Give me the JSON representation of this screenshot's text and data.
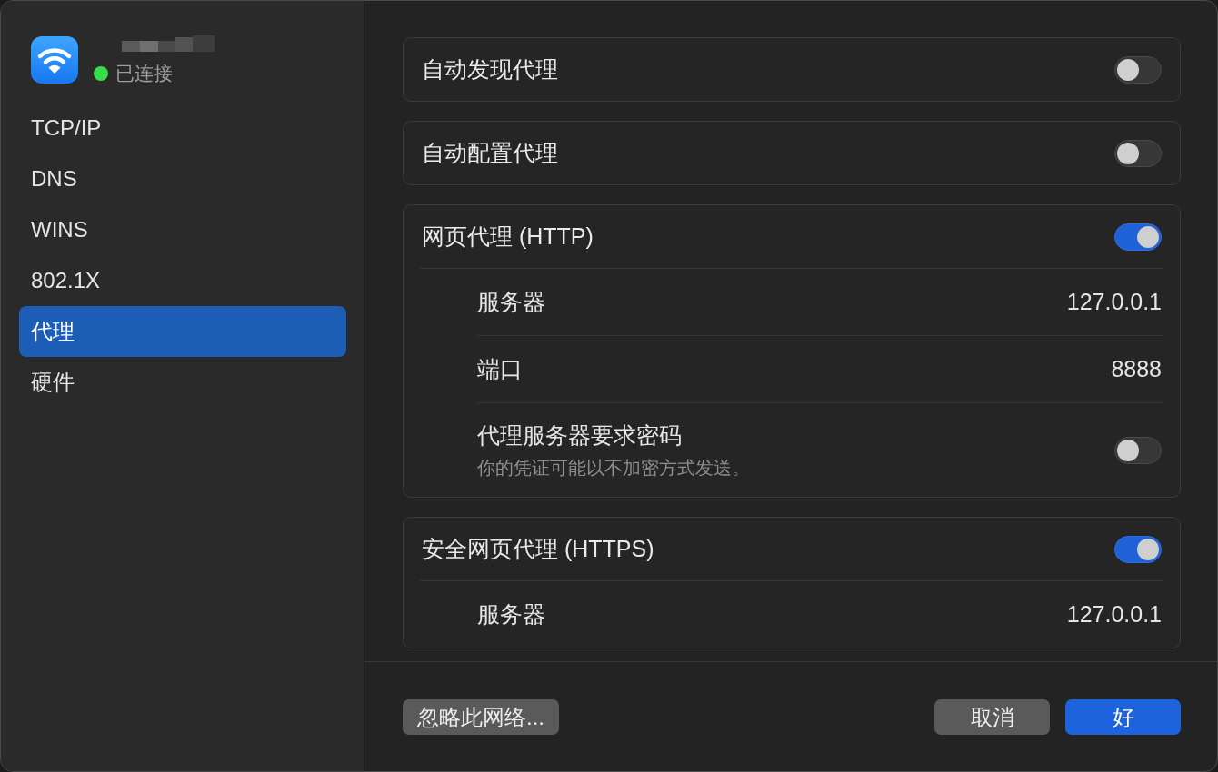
{
  "sidebar": {
    "network": {
      "status": "已连接",
      "connected": true
    },
    "items": [
      {
        "label": "TCP/IP",
        "selected": false
      },
      {
        "label": "DNS",
        "selected": false
      },
      {
        "label": "WINS",
        "selected": false
      },
      {
        "label": "802.1X",
        "selected": false
      },
      {
        "label": "代理",
        "selected": true
      },
      {
        "label": "硬件",
        "selected": false
      }
    ]
  },
  "sections": [
    {
      "label": "自动发现代理",
      "on": false
    },
    {
      "label": "自动配置代理",
      "on": false
    },
    {
      "label": "网页代理 (HTTP)",
      "on": true,
      "rows": [
        {
          "kind": "value",
          "label": "服务器",
          "value": "127.0.0.1"
        },
        {
          "kind": "value",
          "label": "端口",
          "value": "8888"
        },
        {
          "kind": "toggle",
          "label": "代理服务器要求密码",
          "note": "你的凭证可能以不加密方式发送。",
          "on": false
        }
      ]
    },
    {
      "label": "安全网页代理 (HTTPS)",
      "on": true,
      "rows": [
        {
          "kind": "value",
          "label": "服务器",
          "value": "127.0.0.1"
        }
      ]
    }
  ],
  "buttons": [
    {
      "label": "忽略此网络...",
      "kind": "secondary"
    },
    {
      "label": "取消",
      "kind": "secondary"
    },
    {
      "label": "好",
      "kind": "primary"
    }
  ]
}
